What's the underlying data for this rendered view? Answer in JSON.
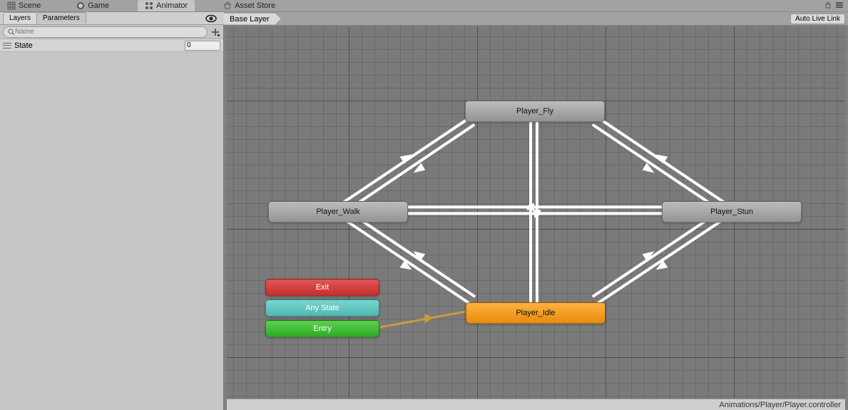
{
  "tabs": {
    "scene": "Scene",
    "game": "Game",
    "animator": "Animator",
    "asset_store": "Asset Store"
  },
  "sub_tabs": {
    "layers": "Layers",
    "parameters": "Parameters"
  },
  "breadcrumb": {
    "base_layer": "Base Layer"
  },
  "buttons": {
    "auto_live_link": "Auto Live Link"
  },
  "search": {
    "placeholder": "Name"
  },
  "parameters": [
    {
      "name": "State",
      "value": "0"
    }
  ],
  "nodes": {
    "player_fly": "Player_Fly",
    "player_walk": "Player_Walk",
    "player_stun": "Player_Stun",
    "player_idle": "Player_Idle",
    "exit": "Exit",
    "any_state": "Any State",
    "entry": "Entry"
  },
  "status": {
    "path": "Animations/Player/Player.controller"
  }
}
